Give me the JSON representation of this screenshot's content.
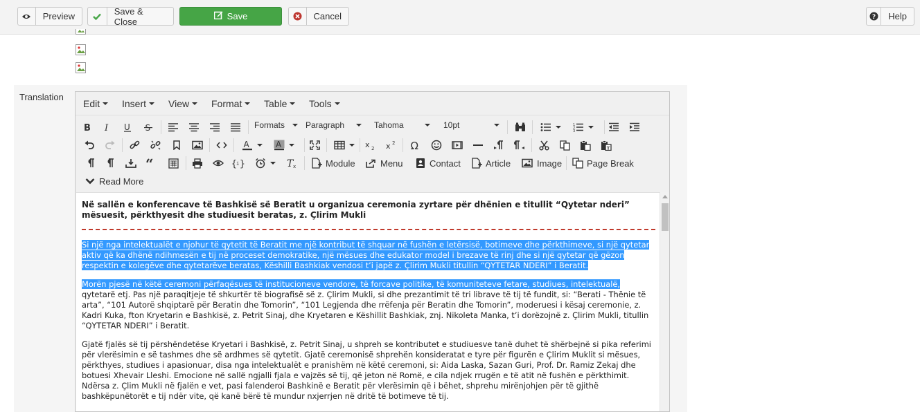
{
  "toolbar": {
    "preview_label": "Preview",
    "save_close_label": "Save & Close",
    "save_label": "Save",
    "cancel_label": "Cancel",
    "help_label": "Help"
  },
  "field": {
    "label": "Translation"
  },
  "editor": {
    "menus": [
      "Edit",
      "Insert",
      "View",
      "Format",
      "Table",
      "Tools"
    ],
    "formats_label": "Formats",
    "block_format": "Paragraph",
    "font_family": "Tahoma",
    "font_size": "10pt",
    "buttons": {
      "module": "Module",
      "menu": "Menu",
      "contact": "Contact",
      "article": "Article",
      "image": "Image",
      "page_break": "Page Break",
      "read_more": "Read More"
    },
    "document": {
      "title": "Në sallën e konferencave të Bashkisë së Beratit u organizua ceremonia zyrtare për dhënien e titullit “Qytetar nderi” mësuesit, përkthyesit dhe studiuesit beratas, z. Çlirim Mukli",
      "p1_selected": "Si një nga intelektualët e njohur të qytetit të Beratit me një kontribut të shquar në fushën e letërsisë, botimeve dhe përkthimeve, si një qytetar aktiv që ka dhënë ndihmesën e tij në proceset demokratike, një mësues dhe edukator model i brezave të rinj dhe si një qytetar që gëzon respektin e kolegëve dhe qytetarëve beratas, Këshilli Bashkiak vendosi t’i japë z. Çlirim Mukli titullin “QYTETAR NDERI” i Beratit.",
      "p2_selected": "Morën pjesë në këtë ceremoni përfaqësues të institucioneve vendore, të forcave politike, të komuniteteve fetare, studiues, intelektualë,",
      "p2_rest": "qytetarë etj. Pas një paraqitjeje të shkurtër të biografisë së z. Çlirim Mukli, si dhe prezantimit të tri librave të tij të fundit, si: “Berati - Thënie të arta”, “101 Autorë shqiptarë për Beratin dhe Tomorin”, “101 Legjenda dhe rrëfenja për Beratin dhe Tomorin”, moderuesi i kësaj ceremonie, z. Kadri Kuka, fton Kryetarin e Bashkisë, z. Petrit Sinaj, dhe Kryetaren e Këshillit Bashkiak, znj. Nikoleta Manka, t’i dorëzojnë z. Çlirim Mukli, titullin “QYTETAR NDERI” i Beratit.",
      "p3": "Gjatë fjalës së tij përshëndetëse Kryetari i Bashkisë, z. Petrit Sinaj, u shpreh se kontributet e studiuesve tanë duhet të shërbejnë si pika referimi për vlerësimin e së tashmes dhe së ardhmes së qytetit. Gjatë ceremonisë shprehën konsideratat e tyre për figurën e Çlirim Muklit si mësues, përkthyes, studiues i apasionuar, disa nga intelektualët e pranishëm në këtë ceremoni, si: Aida Laska, Sazan Guri, Prof. Dr. Ramiz Zekaj dhe botuesi Xhevair Lleshi. Emocione në sallë ngjalli fjala e vajzës së tij, që jeton në Romë, e cila ndjek rrugën e të atit në fushën e përkthimit. Ndërsa z. Çlim Mukli në fjalën e vet, pasi falenderoi Bashkinë e Beratit për vlerësimin që i bëhet, shprehu mirënjohjen për të gjithë bashkëpunëtorët e tij ndër vite, që kanë bërë të mundur nxjerrjen në dritë të botimeve të tij."
    }
  },
  "colors": {
    "save_green": "#46a546",
    "selection_blue": "#3399ff",
    "cancel_red": "#bd362f",
    "hr_red": "#c0392b"
  }
}
